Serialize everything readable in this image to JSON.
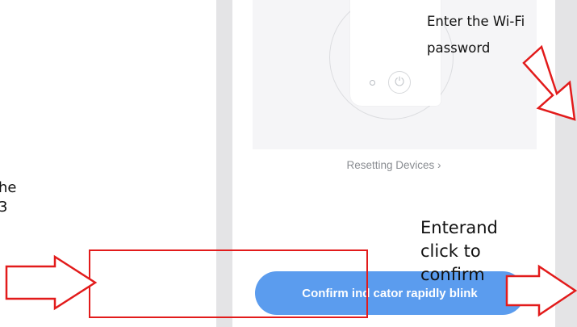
{
  "annotations": {
    "wifi_note": "Enter the Wi-Fi password",
    "confirm_note": "Enterand click to confirm",
    "cut_text_line1": "he",
    "cut_text_line2": "3"
  },
  "screen": {
    "reset_link": "Resetting Devices",
    "reset_chevron": "›",
    "confirm_button": "Confirm ind cator rapidly blink"
  },
  "icons": {
    "device": "smart-plug-icon",
    "power": "power-icon",
    "arrows": "arrow-icon"
  },
  "colors": {
    "accent": "#5b9cee",
    "annotation_red": "#e21b1b"
  }
}
